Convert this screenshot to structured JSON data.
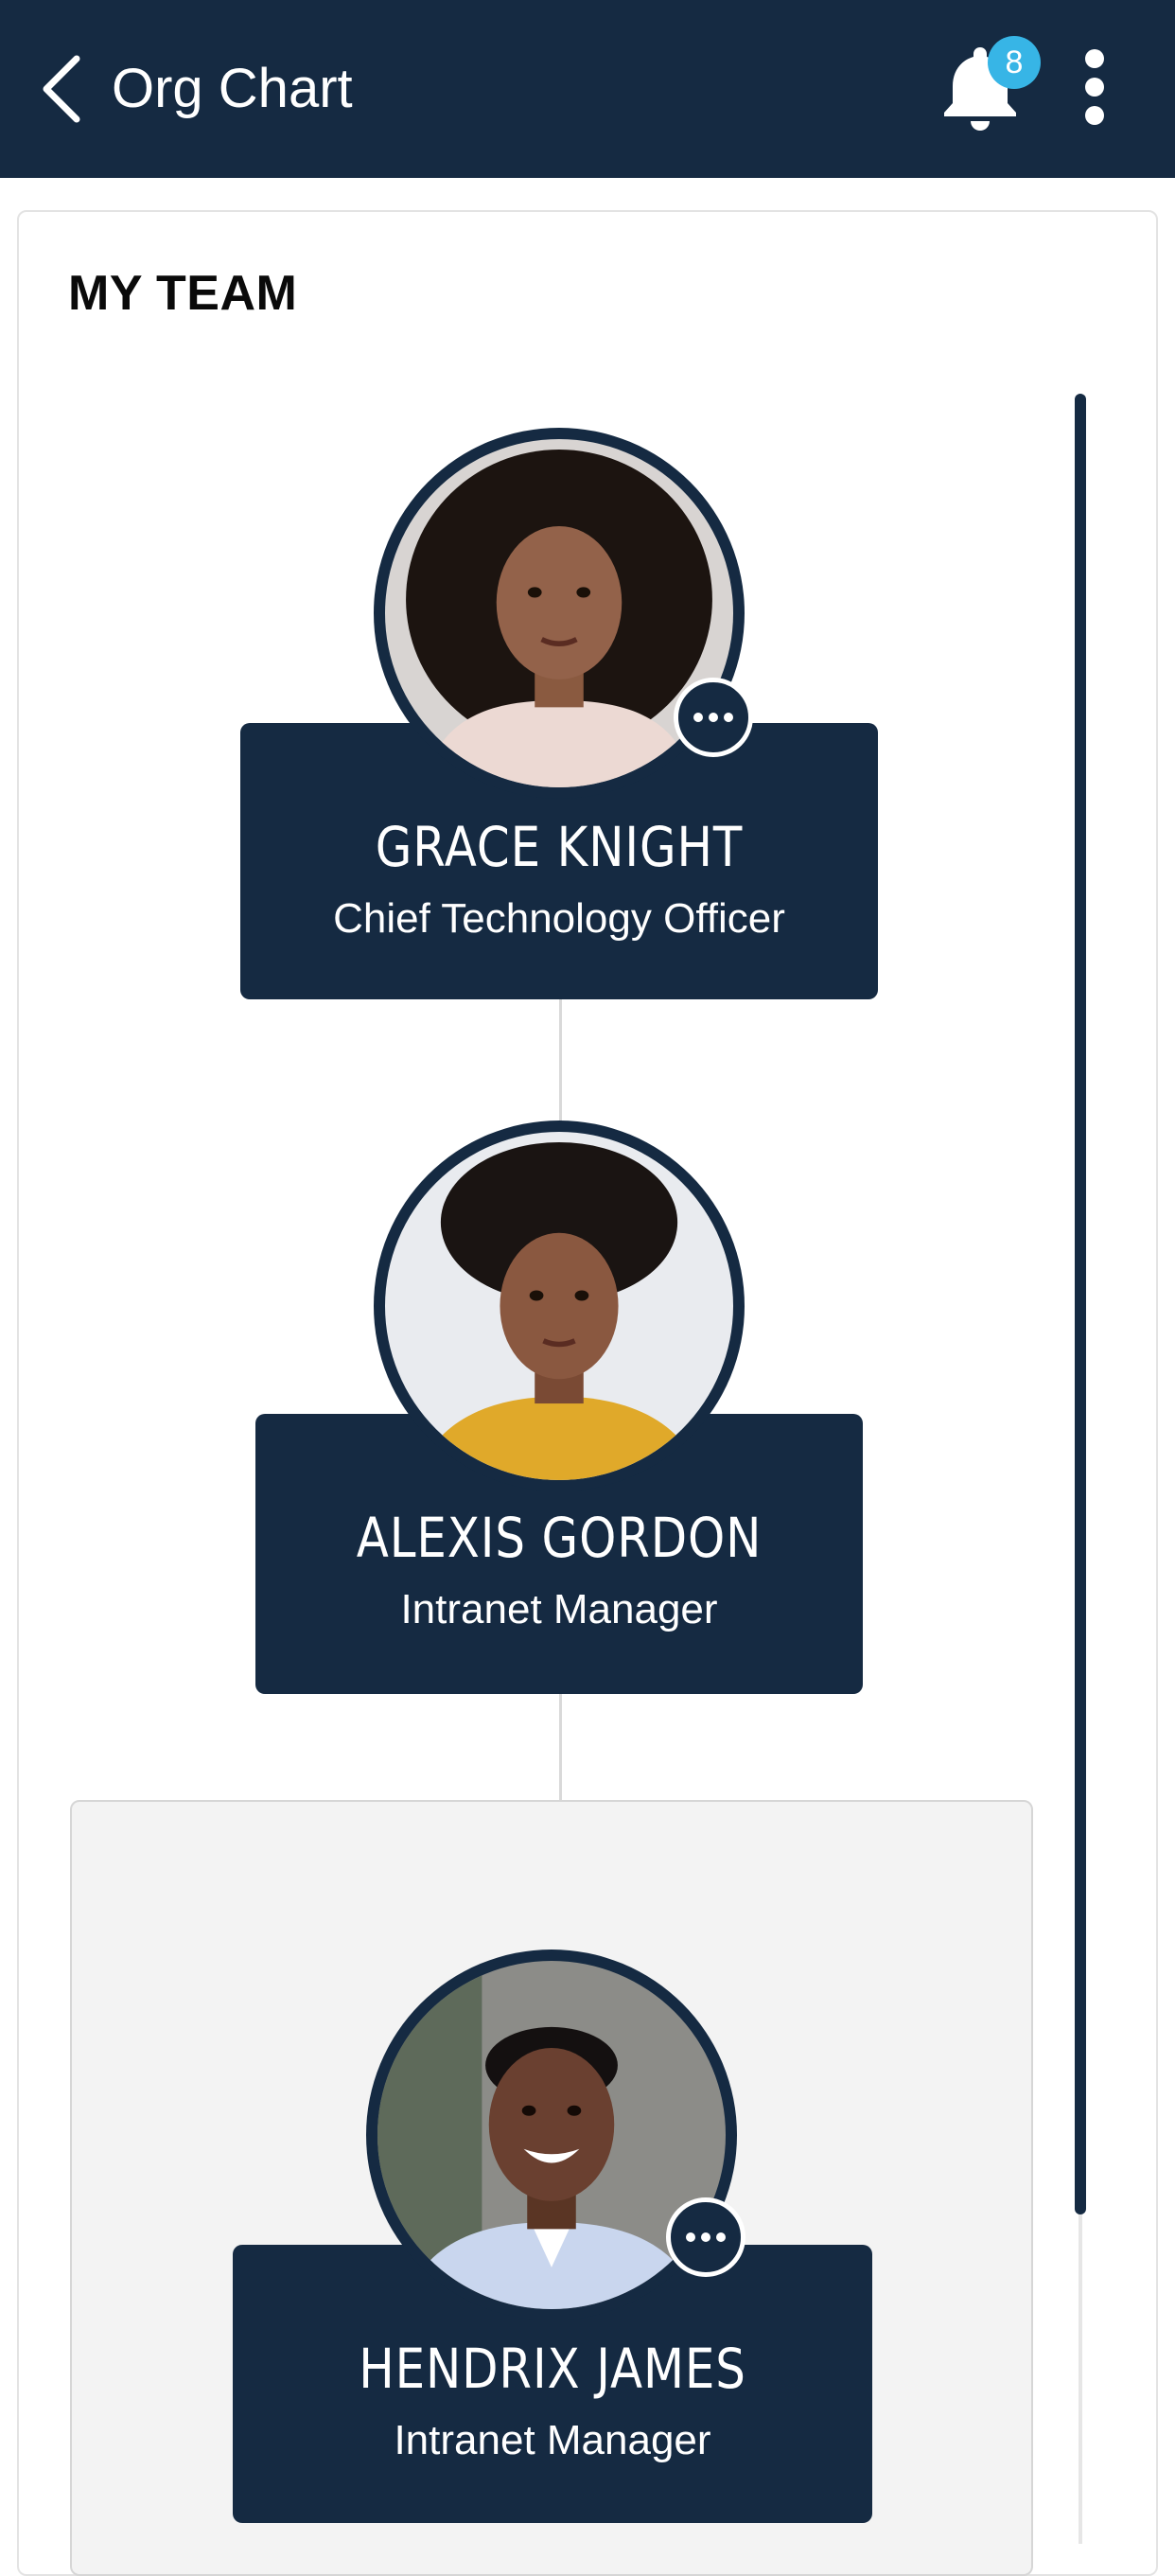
{
  "appbar": {
    "title": "Org Chart",
    "back_icon": "chevron-left-icon",
    "notification_icon": "bell-icon",
    "notification_count": "8",
    "menu_icon": "more-vertical-icon"
  },
  "section": {
    "title": "MY TEAM"
  },
  "people": [
    {
      "name": "GRACE KNIGHT",
      "role": "Chief Technology Officer",
      "has_options": true
    },
    {
      "name": "ALEXIS GORDON",
      "role": "Intranet Manager",
      "has_options": false
    },
    {
      "name": "HENDRIX JAMES",
      "role": "Intranet Manager",
      "has_options": true
    }
  ],
  "colors": {
    "primary": "#152a42",
    "badge": "#37b5e6",
    "group_background": "#f3f3f3",
    "connector": "#d9d9d9"
  }
}
